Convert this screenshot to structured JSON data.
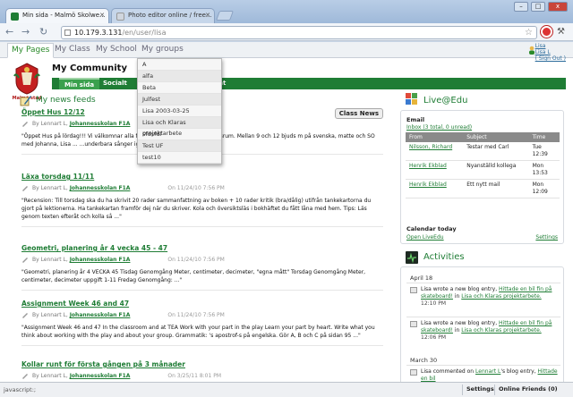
{
  "browser": {
    "tabs": [
      {
        "title": "Min sida - Malmö Skolwe...",
        "active": true
      },
      {
        "title": "Photo editor online / free...",
        "active": false
      }
    ],
    "window_buttons": [
      "–",
      "□",
      "x"
    ],
    "url_host": "10.179.3.131",
    "url_path": "/en/user/lisa"
  },
  "topnav": {
    "items": [
      "My Pages",
      "My Class",
      "My School",
      "My groups"
    ],
    "user_name": "Lisa",
    "user_link": "Lisa L",
    "sign_out": "( Sign Out )"
  },
  "logo_text": "Malmö stad",
  "community_title": "My Community",
  "subnav": {
    "items": [
      "Min sida",
      "Socialt",
      "nt"
    ]
  },
  "dropdown": {
    "items": [
      "A",
      "alfa",
      "Beta",
      "Julfest",
      "Lisa 2003-03-25",
      "Lisa och Klaras projektarbete",
      "sfdsfdf",
      "Test UF",
      "test10"
    ]
  },
  "feed": {
    "title": "My news feeds",
    "class_news_button": "Class News",
    "posts": [
      {
        "title": "Öppet Hus 12/12",
        "author": "By Lennart L,",
        "school": "Johannesskolan F1A",
        "date": "",
        "body": "\"Öppet Hus på lördag!!! Vi välkomnar alla förä... ...nsdag 12/12 i vårt klassrum. Mellan 9 och 12 bjuds m på svenska, matte och SO med Johanna, Lisa ... ...underbara sånger igen! Visa större karta ...\""
      },
      {
        "title": "Läxa torsdag 11/11",
        "author": "By Lennart L,",
        "school": "Johannesskolan F1A",
        "date": "On 11/24/10 7:56 PM",
        "body": "\"Recension: Till torsdag ska du ha skrivit 20 rader sammanfattning av boken + 10 rader kritik (bra/dålig) utifrån tankekartorna du gjort på lektionerna. Ha tankekartan framför dej när du skriver. Kola och översiktsläs i bokhäftet du fått låna med hem. Tips: Läs genom texten efteråt och kolla så ...\""
      },
      {
        "title": "Geometri, planering år 4 vecka 45 - 47",
        "author": "By Lennart L,",
        "school": "Johannesskolan F1A",
        "date": "On 11/24/10 7:56 PM",
        "body": "\"Geometri, planering år 4 VECKA 45 Tisdag     Genomgång Meter, centimeter, decimeter, \"egna mått\" Torsdag     Genomgång Meter, centimeter, decimeter  uppgift 1-11 Fredag        Genomgång: ...\""
      },
      {
        "title": "Assignment Week 46 and 47",
        "author": "By Lennart L,",
        "school": "Johannesskolan F1A",
        "date": "On 11/24/10 7:56 PM",
        "body": "\"Assignment Week 46 and 47 In the classroom and at TEA Work with your part in the play Learn your part by heart. Write what you think about working with the play and about your group. Grammatik: 's apostrof-s på engelska. Gör A, B och C på sidan 95 ...\""
      },
      {
        "title": "Kollar runt för första gången på 3 månader",
        "author": "By Lennart L,",
        "school": "Johannesskolan F1A",
        "date": "On 3/25/11 8:01 PM",
        "body": ""
      }
    ]
  },
  "live_edu": {
    "title": "Live@Edu",
    "email_title": "Email",
    "inbox_link": "Inbox (3 total, 0 unread)",
    "columns": [
      "From",
      "Subject",
      "Time"
    ],
    "rows": [
      {
        "from": "Nilsson, Richard",
        "subject": "Testar med Carl",
        "time": "Tue 12:39"
      },
      {
        "from": "Henrik Ekblad",
        "subject": "Nyanställd kollega",
        "time": "Mon 13:53"
      },
      {
        "from": "Henrik Ekblad",
        "subject": "Ett nytt mail",
        "time": "Mon 12:09"
      }
    ],
    "calendar_title": "Calendar today",
    "open_link": "Open LiveEdu",
    "settings_link": "Settings"
  },
  "activities": {
    "title": "Activities",
    "groups": [
      {
        "date": "April 18",
        "items": [
          {
            "text": "Lisa wrote a new blog entry,",
            "link": "Hittade en bil fin på skateboard!",
            "mid": " in ",
            "link2": "Lisa och Klaras projektarbete.",
            "time": "12:10 PM"
          },
          {
            "text": "Lisa wrote a new blog entry,",
            "link": "Hittade en bil fin på skateboard!",
            "mid": " in ",
            "link2": "Lisa och Klaras projektarbete.",
            "time": "12:06 PM"
          }
        ]
      },
      {
        "date": "March 30",
        "items": [
          {
            "text": "Lisa commented on",
            "link": "Lennart L",
            "mid": "'s blog entry, ",
            "link2": "Hittade en bil",
            "time": ""
          }
        ]
      }
    ]
  },
  "statusbar": {
    "text": "javascript:;",
    "settings": "Settings",
    "online_friends": "Online Friends (0)"
  }
}
